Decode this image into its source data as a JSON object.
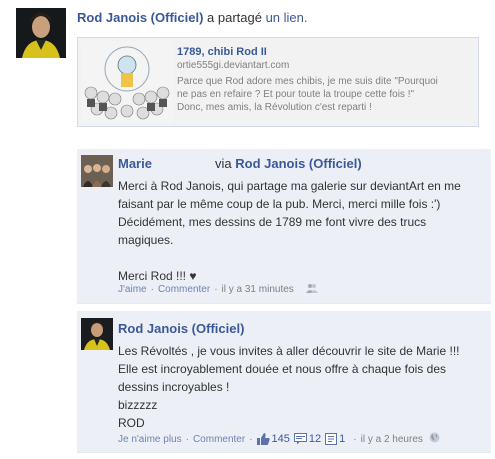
{
  "post": {
    "author": "Rod Janois (Officiel)",
    "verb_prefix": " a partagé ",
    "verb_link": "un lien.",
    "link": {
      "title": "1789, chibi Rod II",
      "url": "ortie555gi.deviantart.com",
      "description_lines": [
        "Parce que Rod adore mes chibis, je me suis dite \"Pourquoi",
        "ne pas en refaire ? Et pour toute la troupe cette fois !\"",
        "Donc, mes amis, la Révolution c'est reparti !"
      ]
    }
  },
  "comments": [
    {
      "author": "Marie",
      "via_word": "via",
      "via_page": "Rod Janois (Officiel)",
      "lines": [
        "Merci à Rod Janois, qui partage ma galerie sur deviantArt en me",
        "faisant par le même coup de la pub. Merci, merci mille fois :')",
        "Décidément, mes dessins de 1789 me font vivre des trucs",
        "magiques.",
        "",
        "Merci Rod !!! ♥"
      ],
      "like_label": "J'aime",
      "comment_label": "Commenter",
      "time": "il y a 31 minutes",
      "icon": "people-icon"
    },
    {
      "author": "Rod Janois (Officiel)",
      "lines": [
        "Les Révoltés , je vous invites à aller découvrir le site de Marie !!!",
        "Elle est incroyablement douée et nous offre à chaque fois des",
        "dessins incroyables !",
        "bizzzzz",
        "ROD"
      ],
      "like_label": "Je n'aime plus",
      "comment_label": "Commenter",
      "likes": "145",
      "comments_count": "12",
      "shares": "1",
      "time": "il y a 2 heures",
      "icon": "globe-icon"
    }
  ],
  "colors": {
    "link": "#3b5998",
    "comment_bg": "#eceff5",
    "muted": "#808080"
  }
}
